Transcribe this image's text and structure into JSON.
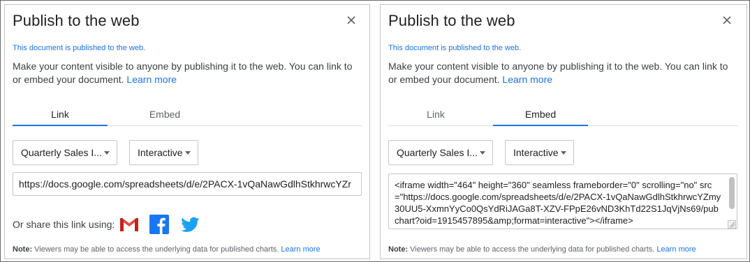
{
  "left_dialog": {
    "title": "Publish to the web",
    "close_label": "×",
    "published_status": "This document is published to the web.",
    "description": "Make your content visible to anyone by publishing it to the web. You can link to or embed your document.",
    "learn_more": "Learn more",
    "tabs": [
      {
        "label": "Link",
        "active": true
      },
      {
        "label": "Embed",
        "active": false
      }
    ],
    "document_select": "Quarterly Sales I...",
    "mode_select": "Interactive",
    "link_url": "https://docs.google.com/spreadsheets/d/e/2PACX-1vQaNawGdlhStkhrwcYZr",
    "share_label": "Or share this link using:",
    "share_icons": [
      "gmail-icon",
      "facebook-icon",
      "twitter-icon"
    ],
    "note_bold": "Note:",
    "note_text": " Viewers may be able to access the underlying data for published charts. ",
    "note_link": "Learn more"
  },
  "right_dialog": {
    "title": "Publish to the web",
    "close_label": "×",
    "published_status": "This document is published to the web.",
    "description": "Make your content visible to anyone by publishing it to the web. You can link to or embed your document.",
    "learn_more": "Learn more",
    "tabs": [
      {
        "label": "Link",
        "active": false
      },
      {
        "label": "Embed",
        "active": true
      }
    ],
    "document_select": "Quarterly Sales I...",
    "mode_select": "Interactive",
    "embed_code": "<iframe width=\"464\" height=\"360\" seamless frameborder=\"0\" scrolling=\"no\" src=\"https://docs.google.com/spreadsheets/d/e/2PACX-1vQaNawGdlhStkhrwcYZmy30UU5-XxmnYyCo0QsYdRiJAGa8T-XZV-FPpE26vND3KhTd22S1JqVjNs69/pubchart?oid=1915457895&amp;format=interactive\"></iframe>",
    "note_bold": "Note:",
    "note_text": " Viewers may be able to access the underlying data for published charts. ",
    "note_link": "Learn more"
  },
  "colors": {
    "accent": "#1a73e8",
    "gmail_red": "#ea4335",
    "facebook_blue": "#1877f2",
    "twitter_blue": "#1da1f2"
  }
}
